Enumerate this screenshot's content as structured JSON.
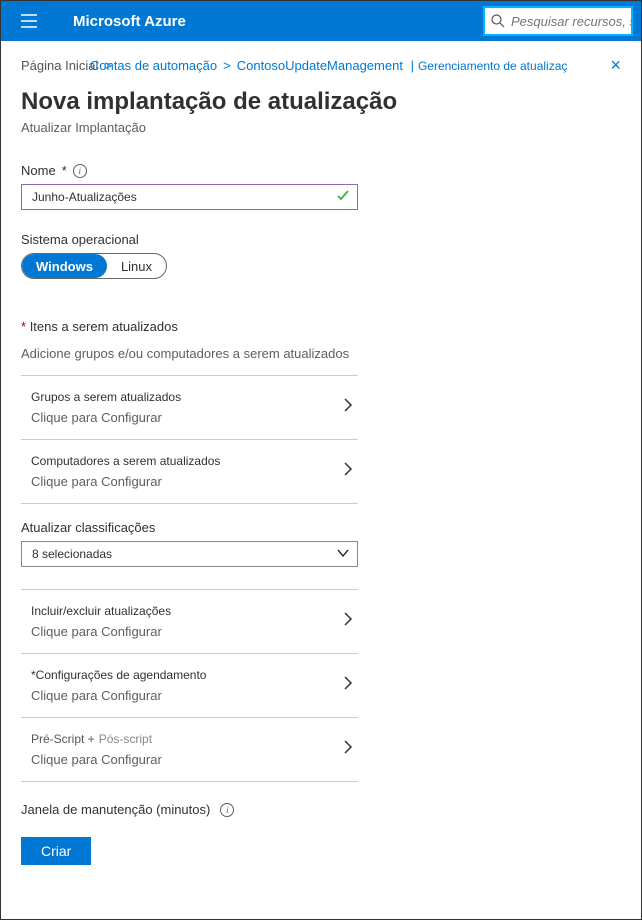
{
  "header": {
    "brand": "Microsoft Azure",
    "search_placeholder": "Pesquisar recursos, s"
  },
  "breadcrumb": {
    "home": "Página Inicial",
    "accounts": "Contas de automação",
    "resource": "ContosoUpdateManagement",
    "section": "Gerenciamento de atualizaç"
  },
  "page": {
    "title": "Nova implantação de atualização",
    "subtitle": "Atualizar Implantação"
  },
  "name_field": {
    "label": "Nome",
    "value": "Junho-Atualizações"
  },
  "os_field": {
    "label": "Sistema operacional",
    "windows": "Windows",
    "linux": "Linux"
  },
  "items_section": {
    "header": "Itens a serem atualizados",
    "help": "Adicione grupos e/ou computadores a serem atualizados"
  },
  "config_rows": {
    "groups": {
      "title": "Grupos a serem atualizados",
      "sub": "Clique para Configurar"
    },
    "computers": {
      "title": "Computadores a serem atualizados",
      "sub": "Clique para Configurar"
    },
    "include_exclude": {
      "title": "Incluir/excluir atualizações",
      "sub": "Clique para Configurar"
    },
    "schedule": {
      "title": "*Configurações de agendamento",
      "sub": "Clique para Configurar"
    },
    "pre_post": {
      "pre": "Pré-Script +",
      "post": "Pós-script",
      "sub": "Clique para Configurar"
    }
  },
  "classifications": {
    "label": "Atualizar classificações",
    "value": "8 selecionadas"
  },
  "maintenance": {
    "label": "Janela de manutenção (minutos)"
  },
  "buttons": {
    "create": "Criar"
  }
}
